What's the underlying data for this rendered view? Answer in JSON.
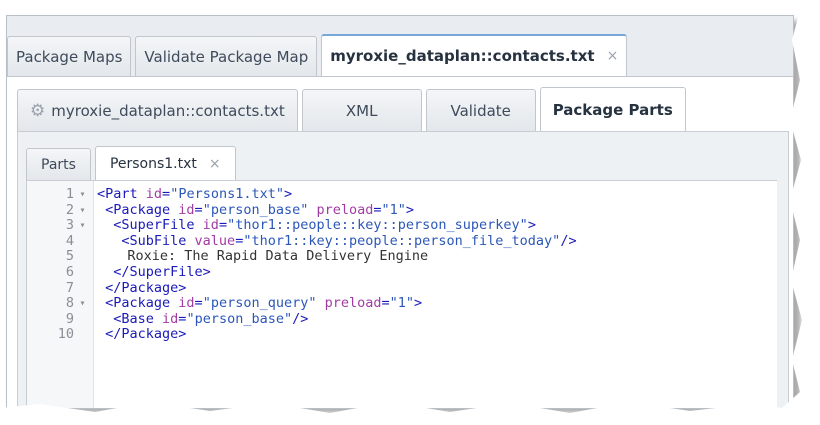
{
  "top_tabs": [
    {
      "label": "Package Maps",
      "active": false
    },
    {
      "label": "Validate Package Map",
      "active": false
    },
    {
      "label": "myroxie_dataplan::contacts.txt",
      "active": true,
      "close": "×"
    }
  ],
  "second_tabs": [
    {
      "label": "myroxie_dataplan::contacts.txt",
      "icon": "gear-icon"
    },
    {
      "label": "XML"
    },
    {
      "label": "Validate"
    },
    {
      "label": "Package Parts",
      "active": true
    }
  ],
  "file_tabs": [
    {
      "label": "Parts"
    },
    {
      "label": "Persons1.txt",
      "active": true,
      "close": "×"
    }
  ],
  "code_lines": [
    {
      "n": "1",
      "fold": "▾",
      "parts": [
        [
          "tg",
          "<Part "
        ],
        [
          "at",
          "id"
        ],
        [
          "tg",
          "="
        ],
        [
          "vl",
          "\"Persons1.txt\""
        ],
        [
          "tg",
          ">"
        ]
      ]
    },
    {
      "n": "2",
      "fold": "▾",
      "parts": [
        [
          "tg",
          " <Package "
        ],
        [
          "at",
          "id"
        ],
        [
          "tg",
          "="
        ],
        [
          "vl",
          "\"person_base\" "
        ],
        [
          "at",
          "preload"
        ],
        [
          "tg",
          "="
        ],
        [
          "vl",
          "\"1\""
        ],
        [
          "tg",
          ">"
        ]
      ]
    },
    {
      "n": "3",
      "fold": "▾",
      "parts": [
        [
          "tg",
          "  <SuperFile "
        ],
        [
          "at",
          "id"
        ],
        [
          "tg",
          "="
        ],
        [
          "vl",
          "\"thor1::people::key::person_superkey\""
        ],
        [
          "tg",
          ">"
        ]
      ]
    },
    {
      "n": "4",
      "fold": "",
      "parts": [
        [
          "tg",
          "   <SubFile "
        ],
        [
          "at",
          "value"
        ],
        [
          "tg",
          "="
        ],
        [
          "vl",
          "\"thor1::key::people::person_file_today\""
        ],
        [
          "tg",
          "/>"
        ]
      ]
    },
    {
      "n": "5",
      "fold": "",
      "parts": [
        [
          "txt",
          "   Roxie: The Rapid Data Delivery Engine"
        ]
      ]
    },
    {
      "n": "6",
      "fold": "",
      "parts": [
        [
          "tg",
          "  </SuperFile>"
        ]
      ]
    },
    {
      "n": "7",
      "fold": "",
      "parts": [
        [
          "tg",
          " </Package>"
        ]
      ]
    },
    {
      "n": "8",
      "fold": "▾",
      "parts": [
        [
          "tg",
          " <Package "
        ],
        [
          "at",
          "id"
        ],
        [
          "tg",
          "="
        ],
        [
          "vl",
          "\"person_query\" "
        ],
        [
          "at",
          "preload"
        ],
        [
          "tg",
          "="
        ],
        [
          "vl",
          "\"1\""
        ],
        [
          "tg",
          ">"
        ]
      ]
    },
    {
      "n": "9",
      "fold": "",
      "parts": [
        [
          "tg",
          "  <Base "
        ],
        [
          "at",
          "id"
        ],
        [
          "tg",
          "="
        ],
        [
          "vl",
          "\"person_base\""
        ],
        [
          "tg",
          "/>"
        ]
      ]
    },
    {
      "n": "10",
      "fold": "",
      "parts": [
        [
          "tg",
          " </Package>"
        ]
      ]
    }
  ]
}
